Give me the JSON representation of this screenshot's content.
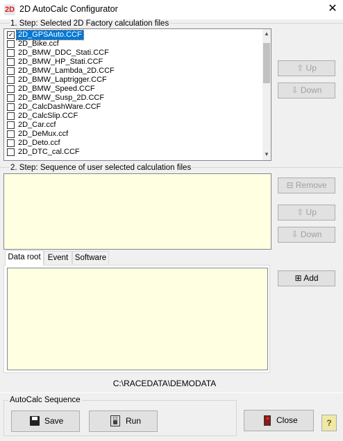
{
  "window": {
    "title": "2D AutoCalc Configurator",
    "close_glyph": "✕",
    "icon_text": "2D"
  },
  "step1": {
    "label": "1. Step: Selected 2D Factory calculation files",
    "files": [
      {
        "name": "2D_GPSAuto.CCF",
        "checked": true,
        "selected": true
      },
      {
        "name": "2D_Bike.ccf",
        "checked": false
      },
      {
        "name": "2D_BMW_DDC_Stati.CCF",
        "checked": false
      },
      {
        "name": "2D_BMW_HP_Stati.CCF",
        "checked": false
      },
      {
        "name": "2D_BMW_Lambda_2D.CCF",
        "checked": false
      },
      {
        "name": "2D_BMW_Laptrigger.CCF",
        "checked": false
      },
      {
        "name": "2D_BMW_Speed.CCF",
        "checked": false
      },
      {
        "name": "2D_BMW_Susp_2D.CCF",
        "checked": false
      },
      {
        "name": "2D_CalcDashWare.CCF",
        "checked": false
      },
      {
        "name": "2D_CalcSlip.CCF",
        "checked": false
      },
      {
        "name": "2D_Car.ccf",
        "checked": false
      },
      {
        "name": "2D_DeMux.ccf",
        "checked": false
      },
      {
        "name": "2D_Deto.ccf",
        "checked": false
      },
      {
        "name": "2D_DTC_cal.CCF",
        "checked": false
      }
    ],
    "up_label": "Up",
    "down_label": "Down"
  },
  "step2": {
    "label": "2. Step: Sequence of user selected calculation files",
    "remove_label": "Remove",
    "up_label": "Up",
    "down_label": "Down"
  },
  "tabs": [
    "Data root",
    "Event",
    "Software"
  ],
  "add_label": "Add",
  "data_path": "C:\\RACEDATA\\DEMODATA",
  "sequence": {
    "label": "AutoCalc Sequence",
    "save_label": "Save",
    "run_label": "Run"
  },
  "close_label": "Close",
  "help_glyph": "?"
}
